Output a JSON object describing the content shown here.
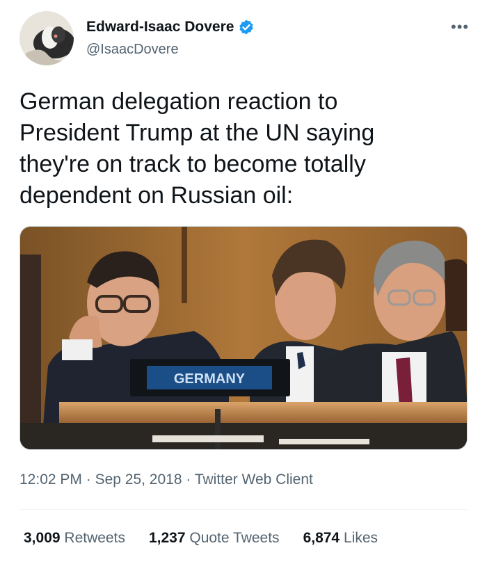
{
  "author": {
    "name": "Edward-Isaac Dovere",
    "handle": "@IsaacDovere",
    "verified_icon": "verified-badge-icon",
    "verified_color": "#1d9bf0"
  },
  "more_icon": "more-dots-icon",
  "tweet": {
    "text_lines": [
      "German delegation reaction to",
      "President Trump at the UN saying",
      "they're on track to become totally",
      "dependent on Russian oil:"
    ]
  },
  "media": {
    "placard_text": "GERMANY"
  },
  "meta": {
    "time": "12:02 PM",
    "separator": "·",
    "date": "Sep 25, 2018",
    "client": "Twitter Web Client"
  },
  "stats": {
    "retweets_count": "3,009",
    "retweets_label": "Retweets",
    "quotes_count": "1,237",
    "quotes_label": "Quote Tweets",
    "likes_count": "6,874",
    "likes_label": "Likes"
  }
}
